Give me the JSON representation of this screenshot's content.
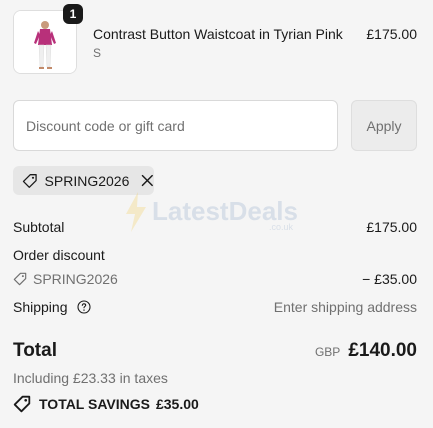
{
  "product": {
    "quantity": "1",
    "title": "Contrast Button Waistcoat in Tyrian Pink",
    "variant": "S",
    "price": "£175.00"
  },
  "discount": {
    "placeholder": "Discount code or gift card",
    "value": "",
    "apply_label": "Apply",
    "applied_code": "SPRING2026"
  },
  "watermark": {
    "brand": "LatestDeals",
    "domain": ".co.uk"
  },
  "summary": {
    "subtotal_label": "Subtotal",
    "subtotal_value": "£175.00",
    "order_discount_label": "Order discount",
    "discount_code": "SPRING2026",
    "discount_value": "− £35.00",
    "shipping_label": "Shipping",
    "shipping_value": "Enter shipping address"
  },
  "total": {
    "label": "Total",
    "currency": "GBP",
    "amount": "£140.00",
    "taxes_note": "Including £23.33 in taxes",
    "savings_label": "TOTAL SAVINGS",
    "savings_amount": "£35.00"
  },
  "icons": {
    "tag": "tag-icon",
    "close": "close-icon",
    "help": "help-circle-icon"
  }
}
